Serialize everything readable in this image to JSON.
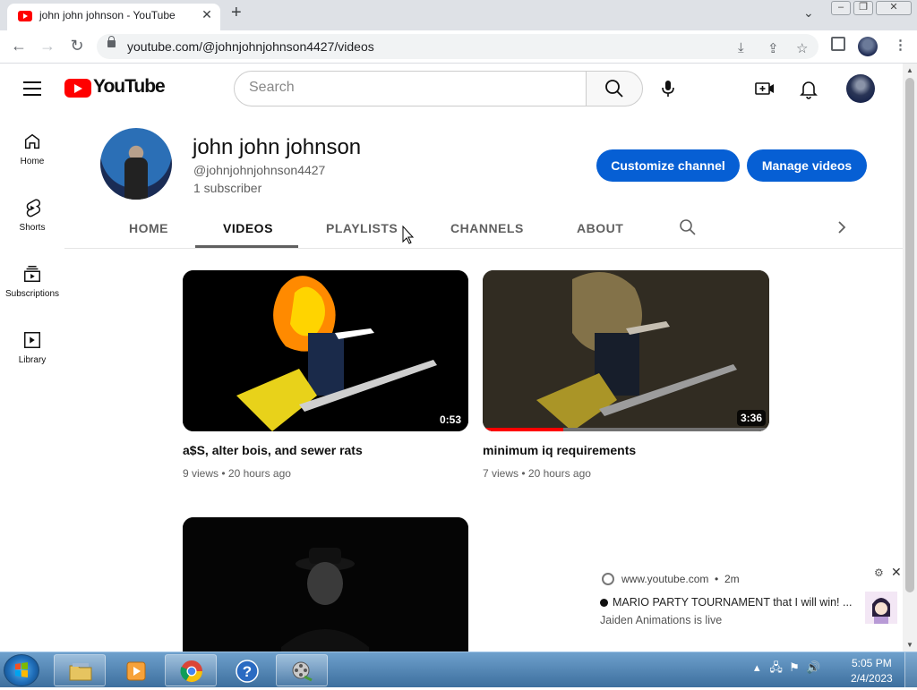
{
  "browser": {
    "tab_title": "john john johnson - YouTube",
    "url": "youtube.com/@johnjohnjohnson4427/videos"
  },
  "youtube": {
    "logo_text": "YouTube",
    "search_placeholder": "Search",
    "brand_color": "#ff0000",
    "accent_color": "#065fd4"
  },
  "sidebar": {
    "items": [
      {
        "label": "Home",
        "icon": "home-icon"
      },
      {
        "label": "Shorts",
        "icon": "shorts-icon"
      },
      {
        "label": "Subscriptions",
        "icon": "subscriptions-icon"
      },
      {
        "label": "Library",
        "icon": "library-icon"
      }
    ]
  },
  "channel": {
    "name": "john john johnson",
    "handle": "@johnjohnjohnson4427",
    "subscribers": "1 subscriber",
    "customize_label": "Customize channel",
    "manage_label": "Manage videos",
    "tabs": [
      "HOME",
      "VIDEOS",
      "PLAYLISTS",
      "CHANNELS",
      "ABOUT"
    ],
    "active_tab": "VIDEOS"
  },
  "videos": [
    {
      "title": "a$S, alter bois, and sewer rats",
      "views": "9 views",
      "age": "20 hours ago",
      "duration": "0:53",
      "watch_progress": 0
    },
    {
      "title": "minimum iq requirements",
      "views": "7 views",
      "age": "20 hours ago",
      "duration": "3:36",
      "watch_progress": 0.28
    },
    {
      "title": "",
      "views": "",
      "age": "",
      "duration": "",
      "watch_progress": 0
    }
  ],
  "notification": {
    "source": "www.youtube.com",
    "time": "2m",
    "title": "MARIO PARTY TOURNAMENT that I will win! ...",
    "body": "Jaiden Animations is live"
  },
  "taskbar": {
    "time": "5:05 PM",
    "date": "2/4/2023"
  }
}
